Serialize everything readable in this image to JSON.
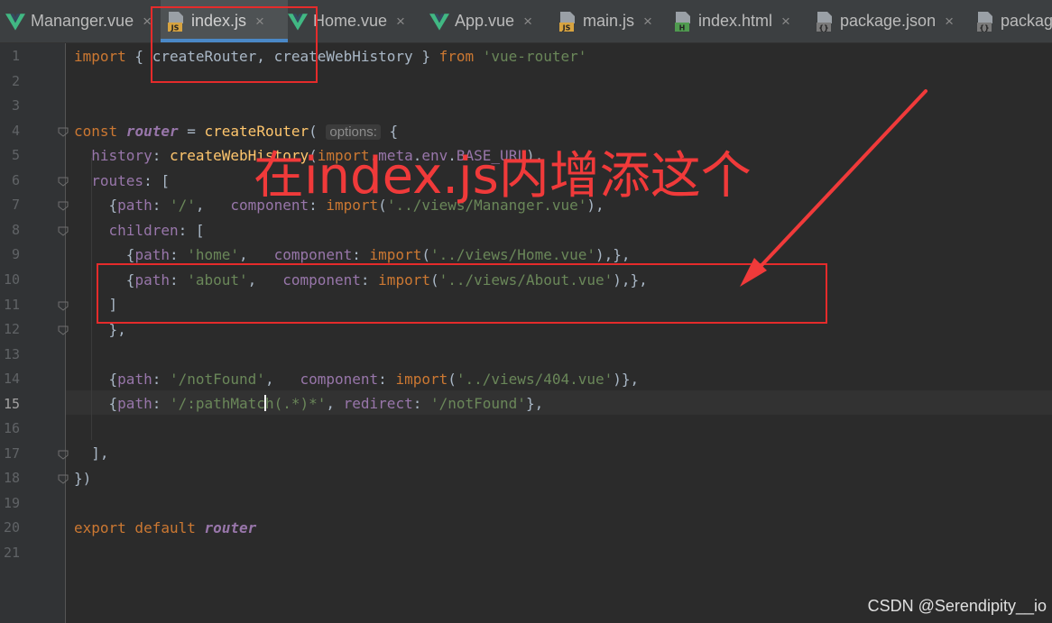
{
  "tabs": [
    {
      "label": "Mananger.vue",
      "type": "vue",
      "icon": "vue-icon"
    },
    {
      "label": "index.js",
      "type": "js",
      "icon": "js-file-icon",
      "active": true
    },
    {
      "label": "Home.vue",
      "type": "vue",
      "icon": "vue-icon"
    },
    {
      "label": "App.vue",
      "type": "vue",
      "icon": "vue-icon"
    },
    {
      "label": "main.js",
      "type": "js",
      "icon": "js-file-icon"
    },
    {
      "label": "index.html",
      "type": "html",
      "icon": "html-file-icon"
    },
    {
      "label": "package.json",
      "type": "json",
      "icon": "json-file-icon"
    },
    {
      "label": "packag",
      "type": "json",
      "icon": "json-file-icon"
    }
  ],
  "tab_close_glyph": "×",
  "editor": {
    "current_line": 15,
    "line_numbers": [
      "1",
      "2",
      "3",
      "4",
      "5",
      "6",
      "7",
      "8",
      "9",
      "10",
      "11",
      "12",
      "13",
      "14",
      "15",
      "16",
      "17",
      "18",
      "19",
      "20",
      "21"
    ],
    "param_hint": "options:"
  },
  "annotation": {
    "text": "在index.js内增添这个",
    "color": "#f03a3a"
  },
  "watermark": "CSDN @Serendipity__io",
  "colors": {
    "keyword": "#cc7832",
    "string": "#6a8759",
    "property": "#9876aa",
    "function": "#ffc66d",
    "default": "#a9b7c6",
    "background": "#2b2b2b",
    "highlight_box": "#e52b2b"
  }
}
